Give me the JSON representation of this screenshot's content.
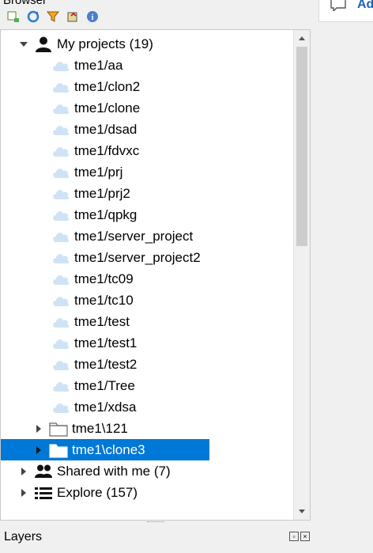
{
  "panel": {
    "title": "Browser"
  },
  "toolbar": {
    "buttons": [
      {
        "name": "add-selected-layers-button",
        "icon": "add-layer-icon"
      },
      {
        "name": "refresh-button",
        "icon": "refresh-icon"
      },
      {
        "name": "filter-button",
        "icon": "filter-icon"
      },
      {
        "name": "collapse-all-button",
        "icon": "collapse-icon"
      },
      {
        "name": "properties-button",
        "icon": "info-icon"
      }
    ]
  },
  "tree": {
    "root": {
      "label": "My projects (19)",
      "icon": "user-icon",
      "expanded": true
    },
    "projects": [
      "tme1/aa",
      "tme1/clon2",
      "tme1/clone",
      "tme1/dsad",
      "tme1/fdvxc",
      "tme1/prj",
      "tme1/prj2",
      "tme1/qpkg",
      "tme1/server_project",
      "tme1/server_project2",
      "tme1/tc09",
      "tme1/tc10",
      "tme1/test",
      "tme1/test1",
      "tme1/test2",
      "tme1/Tree",
      "tme1/xdsa"
    ],
    "local_projects": [
      {
        "label": "tme1\\121",
        "selected": false
      },
      {
        "label": "tme1\\clone3",
        "selected": true
      }
    ],
    "shared": {
      "label": "Shared with me (7)",
      "icon": "users-icon"
    },
    "explore": {
      "label": "Explore (157)",
      "icon": "list-icon"
    }
  },
  "right_panel": {
    "label": "Ad"
  },
  "layers_panel": {
    "title": "Layers"
  },
  "colors": {
    "selection": "#0078d7",
    "cloud": "#cfe3f5",
    "folder": "#777777"
  }
}
